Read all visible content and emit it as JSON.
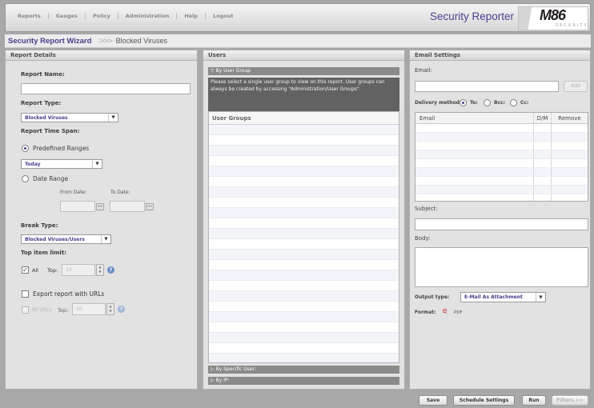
{
  "nav": [
    "Reports",
    "Gauges",
    "Policy",
    "Administration",
    "Help",
    "Logout"
  ],
  "app_title": "Security Reporter",
  "logo": {
    "mark": "M86",
    "sub": "SECURITY"
  },
  "breadcrumb": {
    "main": "Security Report Wizard",
    "sep": ">>>",
    "current": "Blocked Viruses"
  },
  "report_details": {
    "title": "Report Details",
    "report_name_label": "Report Name:",
    "report_name_value": "",
    "report_type_label": "Report Type:",
    "report_type_value": "Blocked Viruses",
    "time_span_label": "Report Time Span:",
    "predefined_label": "Predefined Ranges",
    "predefined_value": "Today",
    "date_range_label": "Date Range",
    "from_date_label": "From Date:",
    "to_date_label": "To Date:",
    "break_type_label": "Break Type:",
    "break_type_value": "Blocked Viruses/Users",
    "top_item_label": "Top item limit:",
    "all_label": "All",
    "top_label": "Top:",
    "top_value": "10",
    "export_label": "Export report with URLs",
    "all_urls_label": "All URLs",
    "top_urls_label": "Top:",
    "top_urls_value": "10"
  },
  "users": {
    "title": "Users",
    "by_group_label": "By User Group",
    "message": "Please select a single user group to view on this report. User groups can always be created by accessing \"Administration/User Groups\".",
    "column_header": "User Groups",
    "by_specific_label": "By Specific User:",
    "by_ip_label": "By IP:"
  },
  "email": {
    "title": "Email Settings",
    "email_label": "Email:",
    "email_value": "",
    "add_label": "Add",
    "delivery_label": "Delivery method",
    "to_label": "To:",
    "bcc_label": "Bcc:",
    "cc_label": "Cc:",
    "col_email": "Email",
    "col_dm": "D/M",
    "col_remove": "Remove",
    "subject_label": "Subject:",
    "body_label": "Body:",
    "output_type_label": "Output type:",
    "output_type_value": "E-Mail As Attachment",
    "format_label": "Format:",
    "format_value": "PDF"
  },
  "buttons": {
    "save": "Save",
    "schedule": "Schedule Settings",
    "run": "Run",
    "filters": "Filters >>"
  }
}
